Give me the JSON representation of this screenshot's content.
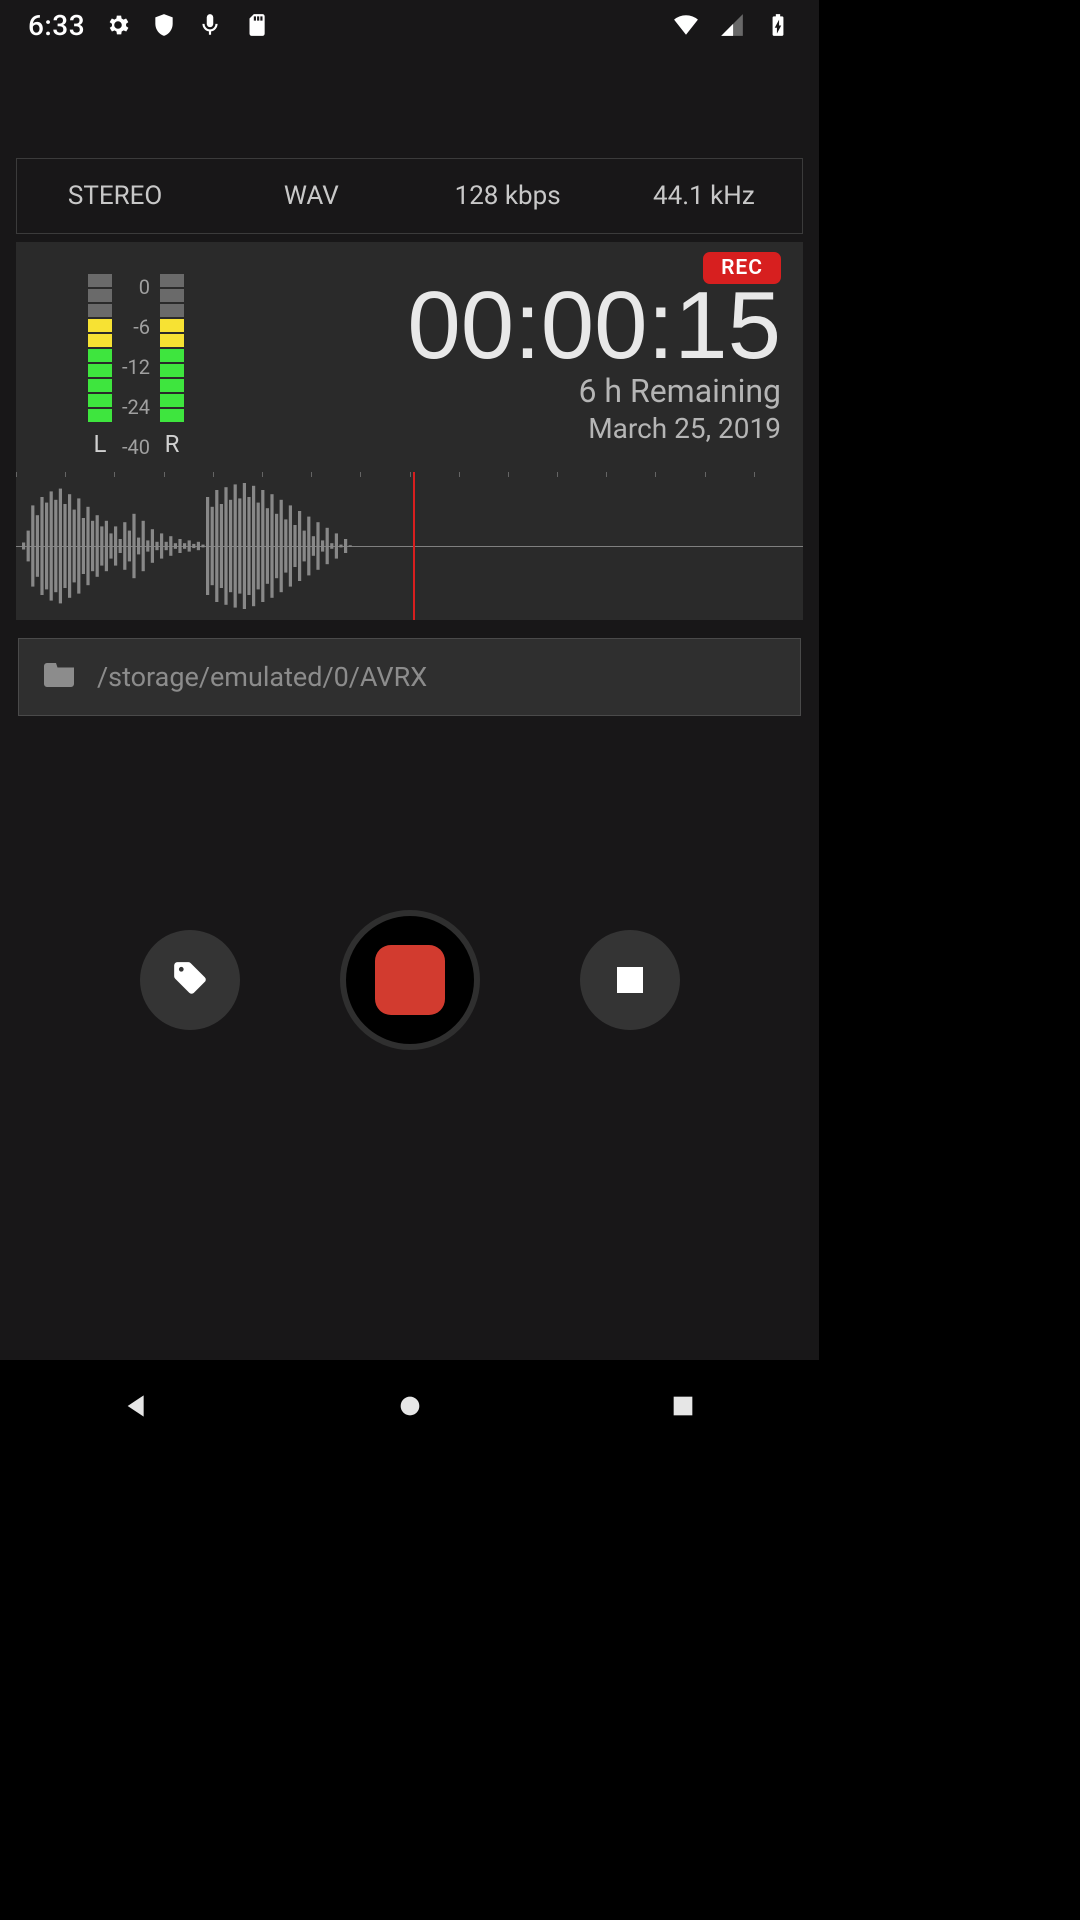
{
  "status": {
    "time": "6:33",
    "icons_left": [
      "gear-icon",
      "shield-icon",
      "microphone-icon",
      "sdcard-icon"
    ],
    "icons_right": [
      "wifi-icon",
      "signal-icon",
      "battery-charging-icon"
    ]
  },
  "format": {
    "channels": "STEREO",
    "codec": "WAV",
    "bitrate": "128 kbps",
    "samplerate": "44.1 kHz"
  },
  "meter": {
    "db_marks": [
      "0",
      "-6",
      "-12",
      "-24",
      "-40"
    ],
    "left_label": "L",
    "right_label": "R",
    "left_levels": [
      "off",
      "off",
      "off",
      "yellow",
      "yellow",
      "green",
      "green",
      "green",
      "green",
      "green"
    ],
    "right_levels": [
      "off",
      "off",
      "off",
      "yellow",
      "yellow",
      "green",
      "green",
      "green",
      "green",
      "green"
    ]
  },
  "recording": {
    "badge": "REC",
    "elapsed": "00:00:15",
    "remaining": "6 h Remaining",
    "date": "March 25, 2019",
    "playhead_pct": 50.5
  },
  "storage": {
    "path": "/storage/emulated/0/AVRX"
  },
  "controls": {
    "tag": "tag-icon",
    "record": "record",
    "stop": "stop"
  },
  "nav": [
    "back",
    "home",
    "recent"
  ],
  "colors": {
    "accent_red": "#d71f1f",
    "panel": "#2a2a2a"
  },
  "waveform": {
    "amplitudes": [
      5,
      22,
      58,
      44,
      70,
      62,
      78,
      66,
      82,
      60,
      74,
      52,
      68,
      40,
      56,
      36,
      44,
      28,
      36,
      18,
      28,
      10,
      34,
      22,
      46,
      12,
      36,
      8,
      24,
      6,
      18,
      6,
      14,
      4,
      10,
      4,
      8,
      3,
      6,
      2,
      70,
      56,
      80,
      60,
      84,
      66,
      88,
      68,
      90,
      70,
      86,
      62,
      80,
      54,
      74,
      46,
      66,
      38,
      58,
      30,
      50,
      22,
      42,
      14,
      34,
      8,
      26,
      4,
      18,
      2,
      10,
      1
    ]
  }
}
